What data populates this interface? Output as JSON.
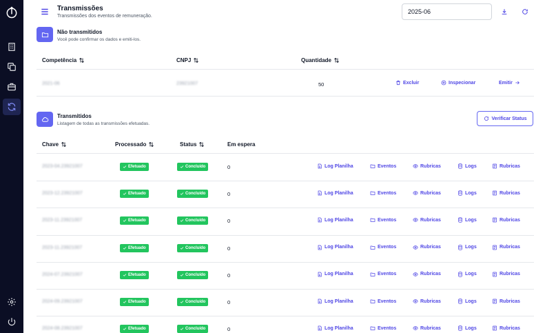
{
  "sidebar": {
    "items": [
      {
        "icon": "building-icon"
      },
      {
        "icon": "copy-icon"
      },
      {
        "icon": "briefcase-icon"
      },
      {
        "icon": "sync-icon",
        "active": true
      }
    ],
    "bottom": [
      {
        "icon": "gear-icon"
      },
      {
        "icon": "power-icon"
      }
    ]
  },
  "header": {
    "title": "Transmissões",
    "subtitle": "Transmissões dos eventos de remuneração.",
    "period": "2025-06"
  },
  "pending": {
    "title": "Não transmitidos",
    "subtitle": "Você pode confirmar os dados e emiti-los.",
    "columns": [
      "Competência",
      "CNPJ",
      "Quantidade"
    ],
    "row": {
      "competencia": "2021-06",
      "cnpj": "23921007",
      "quantidade": "50",
      "actions": [
        "Excluir",
        "Inspecionar",
        "Emitir"
      ]
    }
  },
  "sent": {
    "title": "Transmitidos",
    "subtitle": "Listagem de todas as transmissões efetuadas.",
    "verify_label": "Verificar Status",
    "columns": [
      "Chave",
      "Processado",
      "Status",
      "Em espera"
    ],
    "actions": [
      "Log Planilha",
      "Eventos",
      "Rubricas",
      "Logs",
      "Rubricas"
    ],
    "rows": [
      {
        "chave": "2023-04.23921007",
        "processado": "Efetuado",
        "status": "Concluído",
        "em_espera": "0"
      },
      {
        "chave": "2023-12.23921007",
        "processado": "Efetuado",
        "status": "Concluído",
        "em_espera": "0"
      },
      {
        "chave": "2023-11.23921007",
        "processado": "Efetuado",
        "status": "Concluído",
        "em_espera": "0"
      },
      {
        "chave": "2023-11.23921007",
        "processado": "Efetuado",
        "status": "Concluído",
        "em_espera": "0"
      },
      {
        "chave": "2024-07.23921007",
        "processado": "Efetuado",
        "status": "Concluído",
        "em_espera": "0"
      },
      {
        "chave": "2024-09.23921007",
        "processado": "Efetuado",
        "status": "Concluído",
        "em_espera": "0"
      },
      {
        "chave": "2024-08.23921007",
        "processado": "Efetuado",
        "status": "Concluído",
        "em_espera": "0"
      }
    ]
  },
  "colors": {
    "accent": "#4f46e5",
    "success": "#22c55e",
    "sidebar": "#0b0e24"
  }
}
